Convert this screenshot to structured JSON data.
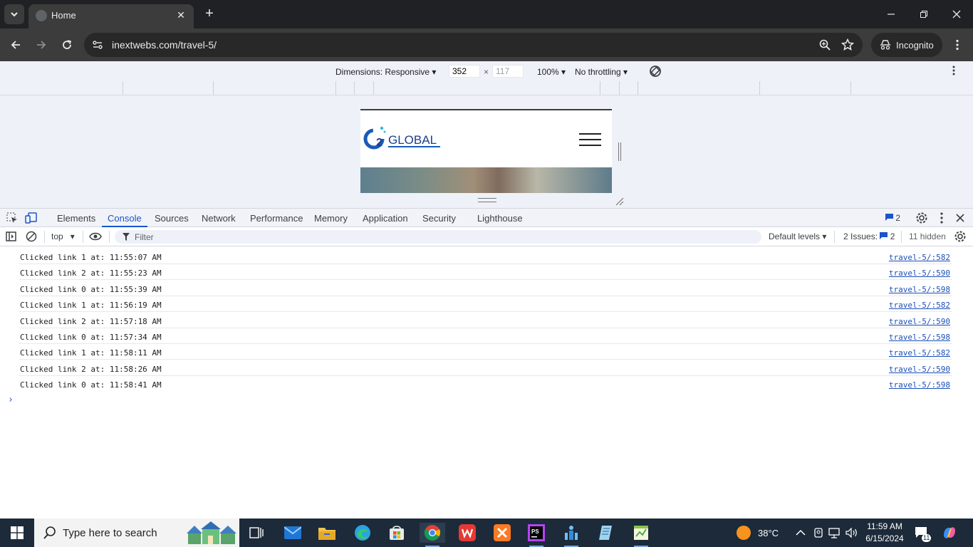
{
  "browser": {
    "tab_title": "Home",
    "url": "inextwebs.com/travel-5/",
    "incognito_label": "Incognito"
  },
  "device_toolbar": {
    "dimensions_label": "Dimensions: Responsive",
    "width": "352",
    "height": "117",
    "times": "×",
    "zoom": "100%",
    "throttling": "No throttling"
  },
  "site": {
    "logo_text": "GLOBAL"
  },
  "devtools": {
    "tabs": [
      "Elements",
      "Console",
      "Sources",
      "Network",
      "Performance",
      "Memory",
      "Application",
      "Security",
      "Lighthouse"
    ],
    "active_tab": "Console",
    "messages_badge": "2"
  },
  "console_toolbar": {
    "context": "top",
    "filter_placeholder": "Filter",
    "levels": "Default levels",
    "issues_label": "2 Issues:",
    "issues_count": "2",
    "hidden": "11 hidden"
  },
  "console_messages": [
    {
      "text": "Clicked link 1 at: 11:55:07 AM",
      "source": "travel-5/:582"
    },
    {
      "text": "Clicked link 2 at: 11:55:23 AM",
      "source": "travel-5/:590"
    },
    {
      "text": "Clicked link 0 at: 11:55:39 AM",
      "source": "travel-5/:598"
    },
    {
      "text": "Clicked link 1 at: 11:56:19 AM",
      "source": "travel-5/:582"
    },
    {
      "text": "Clicked link 2 at: 11:57:18 AM",
      "source": "travel-5/:590"
    },
    {
      "text": "Clicked link 0 at: 11:57:34 AM",
      "source": "travel-5/:598"
    },
    {
      "text": "Clicked link 1 at: 11:58:11 AM",
      "source": "travel-5/:582"
    },
    {
      "text": "Clicked link 2 at: 11:58:26 AM",
      "source": "travel-5/:590"
    },
    {
      "text": "Clicked link 0 at: 11:58:41 AM",
      "source": "travel-5/:598"
    }
  ],
  "taskbar": {
    "search_placeholder": "Type here to search",
    "temperature": "38°C",
    "time": "11:59 AM",
    "date": "6/15/2024",
    "notifications": "11"
  },
  "colors": {
    "accent": "#1a55c9",
    "link": "#1a4fb9",
    "taskbar": "#1c2a3a"
  }
}
